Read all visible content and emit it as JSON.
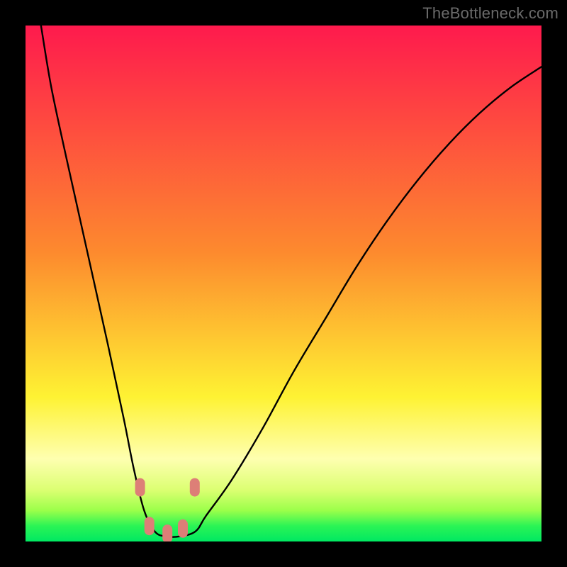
{
  "watermark": "TheBottleneck.com",
  "colors": {
    "red_top": "#fe1a4d",
    "orange": "#fd8a2e",
    "yellow": "#fef233",
    "pale_yellow": "#feffb0",
    "yellow_green": "#dcff72",
    "lime": "#9bff4a",
    "green_band": "#2bf455",
    "green_bottom": "#00e862",
    "curve": "#000000",
    "marker": "#dd7f77",
    "frame_bg": "#000000"
  },
  "chart_data": {
    "type": "line",
    "title": "",
    "xlabel": "",
    "ylabel": "",
    "xlim": [
      0,
      100
    ],
    "ylim": [
      0,
      100
    ],
    "series": [
      {
        "name": "bottleneck-curve",
        "x": [
          3,
          5,
          8,
          12,
          16,
          19,
          21,
          23,
          25,
          27,
          30,
          33,
          35,
          40,
          46,
          52,
          58,
          64,
          70,
          76,
          82,
          88,
          94,
          100
        ],
        "y": [
          100,
          88,
          74,
          56,
          38,
          24,
          14,
          6,
          2,
          1,
          1,
          2,
          5,
          12,
          22,
          33,
          43,
          53,
          62,
          70,
          77,
          83,
          88,
          92
        ]
      }
    ],
    "markers": [
      {
        "x": 22.2,
        "y": 10.5
      },
      {
        "x": 24.0,
        "y": 3.0
      },
      {
        "x": 27.5,
        "y": 1.5
      },
      {
        "x": 30.5,
        "y": 2.5
      },
      {
        "x": 32.8,
        "y": 10.5
      }
    ],
    "gradient_stops_pct": [
      {
        "pct": 0,
        "color": "red_top"
      },
      {
        "pct": 44,
        "color": "orange"
      },
      {
        "pct": 72,
        "color": "yellow"
      },
      {
        "pct": 84,
        "color": "pale_yellow"
      },
      {
        "pct": 90,
        "color": "yellow_green"
      },
      {
        "pct": 94,
        "color": "lime"
      },
      {
        "pct": 97,
        "color": "green_band"
      },
      {
        "pct": 100,
        "color": "green_bottom"
      }
    ]
  }
}
